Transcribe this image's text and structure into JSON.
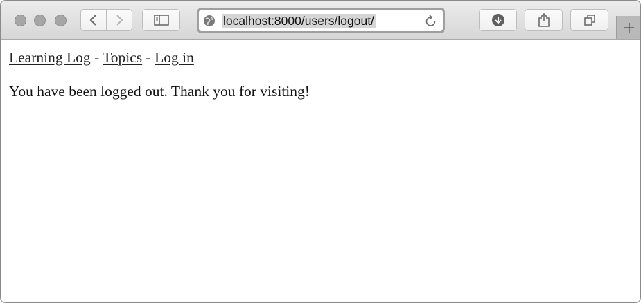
{
  "browser": {
    "url": "localhost:8000/users/logout/"
  },
  "nav": {
    "link_learning_log": "Learning Log",
    "sep1": " - ",
    "link_topics": "Topics",
    "sep2": " - ",
    "link_login": "Log in"
  },
  "page": {
    "message": "You have been logged out. Thank you for visiting!"
  },
  "icons": {
    "traffic_lights": [
      "close-icon",
      "minimize-icon",
      "zoom-icon"
    ],
    "nav_back": "chevron-left-icon",
    "nav_forward": "chevron-right-icon",
    "sidebar": "sidebar-icon",
    "site": "globe-icon",
    "reload": "reload-icon",
    "downloads": "download-icon",
    "share": "share-icon",
    "tabs": "tabs-overview-icon",
    "new_tab": "plus-icon"
  }
}
